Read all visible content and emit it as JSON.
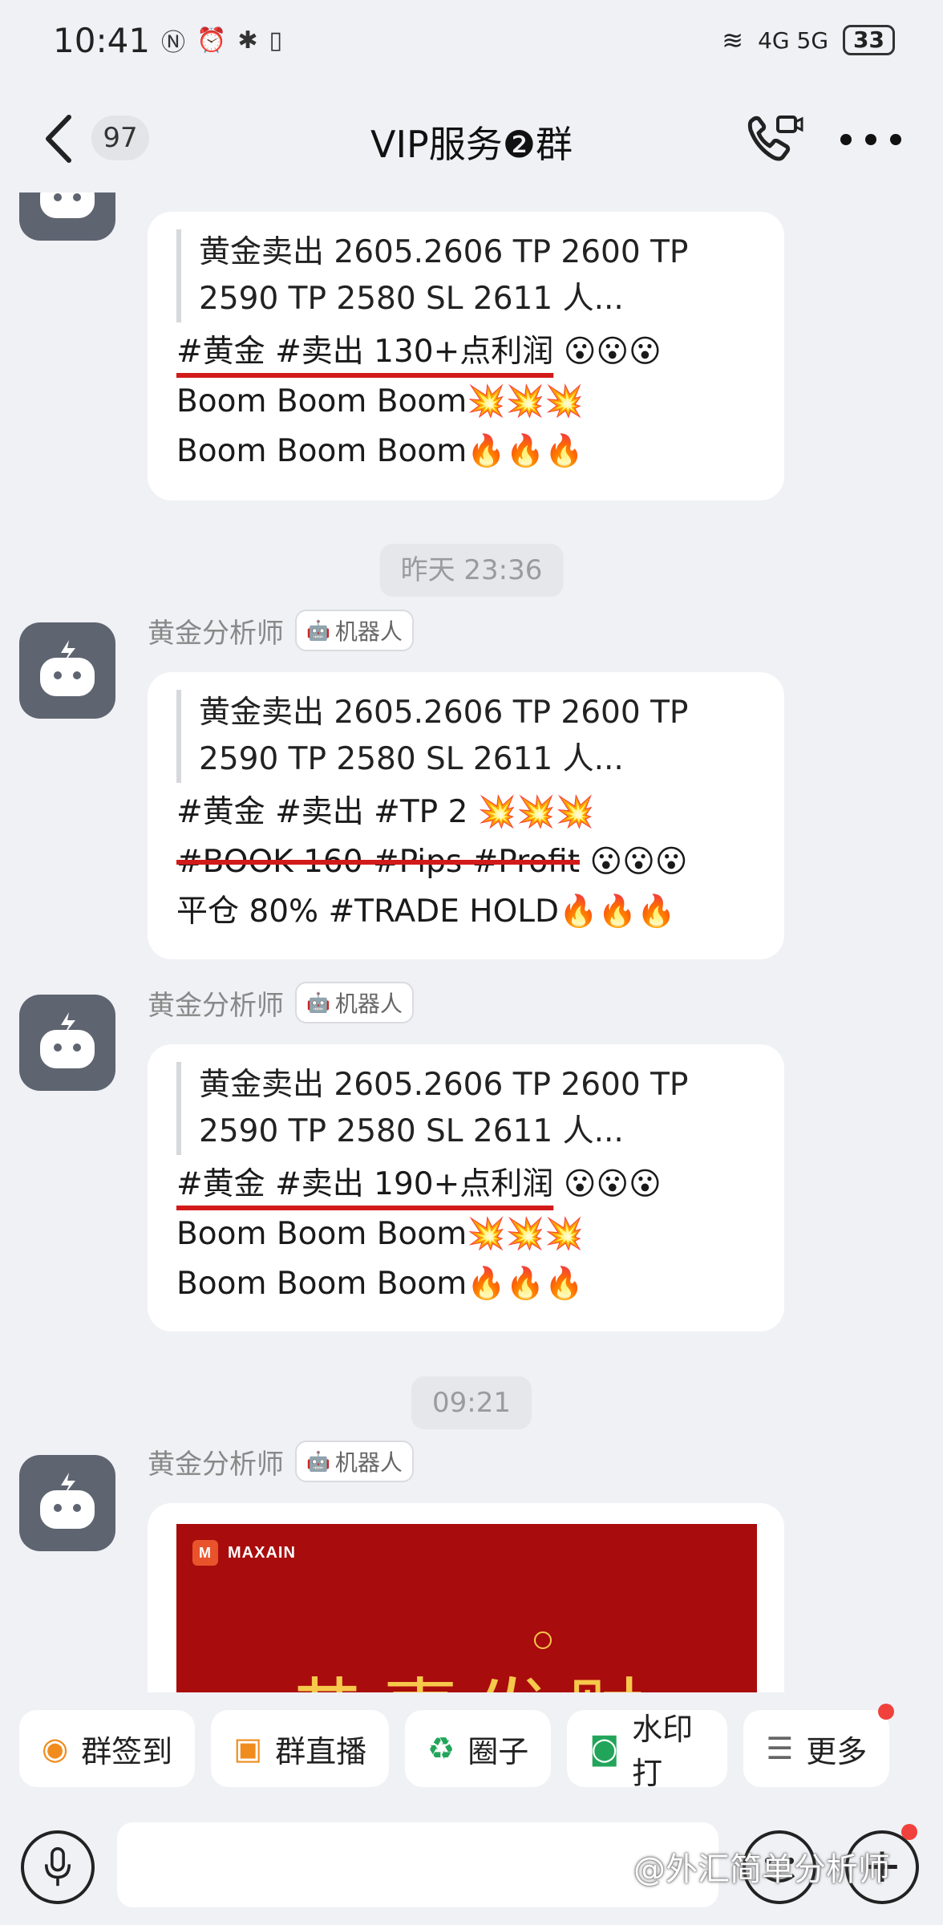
{
  "status_bar": {
    "time": "10:41",
    "icons": [
      "nfc-icon",
      "alarm-icon",
      "bluetooth-icon",
      "vibrate-icon"
    ],
    "network": "4G 5G",
    "battery": "33"
  },
  "header": {
    "unread_count": "97",
    "title": "VIP服务❷群"
  },
  "messages": [
    {
      "quote": "黄金卖出 2605.2606  TP 2600 TP 2590 TP 2580  SL 2611 人...",
      "lines": [
        {
          "underline": "#黄金 #卖出 130+点利润",
          "emoji": "😮😮😮"
        },
        {
          "text": "Boom Boom Boom💥💥💥"
        },
        {
          "text": "Boom Boom Boom🔥🔥🔥"
        }
      ]
    },
    {
      "time": "昨天 23:36",
      "sender": "黄金分析师",
      "tag": "机器人",
      "quote": "黄金卖出 2605.2606  TP 2600 TP 2590 TP 2580  SL 2611 人...",
      "lines": [
        {
          "text": "#黄金 #卖出 #TP 2 💥💥💥"
        },
        {
          "strike": "#BOOK 160 #Pips #Profit",
          "emoji": "😮😮😮"
        },
        {
          "text": "平仓 80% #TRADE HOLD🔥🔥🔥"
        }
      ]
    },
    {
      "sender": "黄金分析师",
      "tag": "机器人",
      "quote": "黄金卖出 2605.2606  TP 2600 TP 2590 TP 2580  SL 2611 人...",
      "lines": [
        {
          "underline": "#黄金 #卖出 190+点利润",
          "emoji": "😮😮😮"
        },
        {
          "text": "Boom Boom Boom💥💥💥"
        },
        {
          "text": "Boom Boom Boom🔥🔥🔥"
        }
      ]
    },
    {
      "time": "09:21",
      "sender": "黄金分析师",
      "tag": "机器人",
      "image": {
        "brand": "MAXAIN",
        "text": "恭喜发财"
      }
    }
  ],
  "quick_actions": [
    {
      "icon": "location-pin-icon",
      "label": "群签到"
    },
    {
      "icon": "tv-icon",
      "label": "群直播"
    },
    {
      "icon": "circle-network-icon",
      "label": "圈子"
    },
    {
      "icon": "camera-icon",
      "label": "水印打"
    },
    {
      "icon": "menu-icon",
      "label": "更多"
    }
  ],
  "input": {
    "placeholder": ""
  },
  "watermark": "@外汇简单分析师",
  "colors": {
    "accent_orange": "#f08c1e",
    "underline_red": "#d21a1a",
    "avatar_gray": "#5e6470"
  }
}
